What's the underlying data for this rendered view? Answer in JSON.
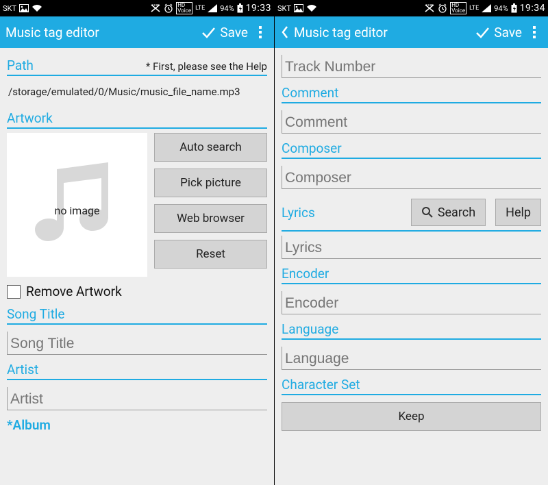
{
  "statusbar": {
    "carrier": "SKT",
    "hd": "HD",
    "voice": "Voice",
    "lte": "LTE",
    "battery_pct": "94%",
    "time_left": "19:33",
    "time_right": "19:34"
  },
  "actionbar": {
    "title": "Music tag editor",
    "save": "Save"
  },
  "left": {
    "path_label": "Path",
    "help_hint": "* First, please see the Help",
    "path_value": "/storage/emulated/0/Music/music_file_name.mp3",
    "artwork_label": "Artwork",
    "no_image": "no image",
    "btn_auto": "Auto search",
    "btn_pick": "Pick picture",
    "btn_web": "Web browser",
    "btn_reset": "Reset",
    "remove_artwork": "Remove Artwork",
    "song_title_label": "Song Title",
    "song_title_ph": "Song Title",
    "artist_label": "Artist",
    "artist_ph": "Artist",
    "album_label": "*Album"
  },
  "right": {
    "track_number_ph": "Track Number",
    "comment_label": "Comment",
    "comment_ph": "Comment",
    "composer_label": "Composer",
    "composer_ph": "Composer",
    "lyrics_label": "Lyrics",
    "search_btn": "Search",
    "help_btn": "Help",
    "lyrics_ph": "Lyrics",
    "encoder_label": "Encoder",
    "encoder_ph": "Encoder",
    "language_label": "Language",
    "language_ph": "Language",
    "charset_label": "Character Set",
    "keep_btn": "Keep"
  }
}
